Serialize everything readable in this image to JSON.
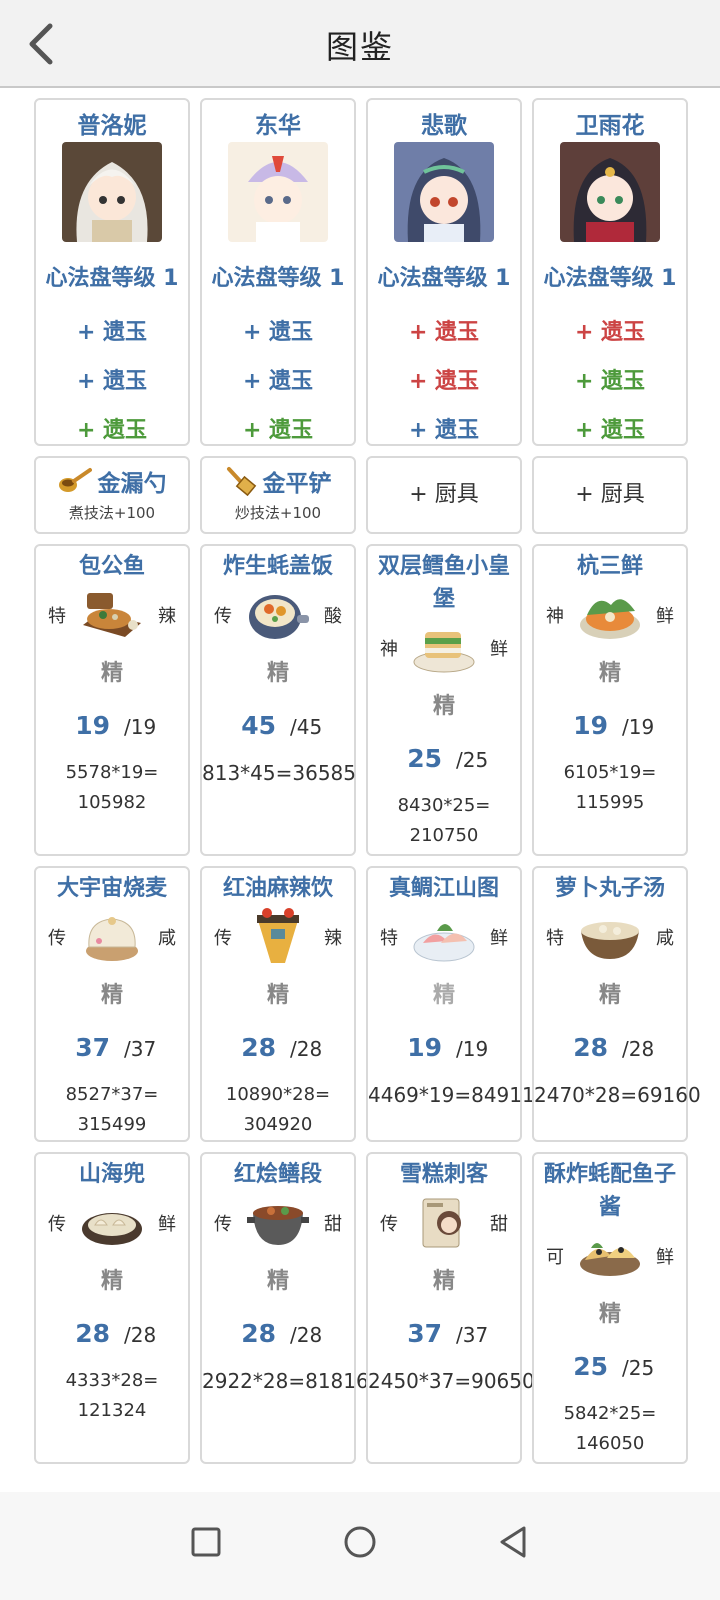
{
  "header": {
    "title": "图鉴"
  },
  "chefs": [
    {
      "name": "普洛妮",
      "level": "心法盘等级 1",
      "jades": [
        {
          "text": "+ 遗玉",
          "color": "blue"
        },
        {
          "text": "+ 遗玉",
          "color": "blue"
        },
        {
          "text": "+ 遗玉",
          "color": "green"
        }
      ]
    },
    {
      "name": "东华",
      "level": "心法盘等级 1",
      "jades": [
        {
          "text": "+ 遗玉",
          "color": "blue"
        },
        {
          "text": "+ 遗玉",
          "color": "blue"
        },
        {
          "text": "+ 遗玉",
          "color": "green"
        }
      ]
    },
    {
      "name": "悲歌",
      "level": "心法盘等级 1",
      "jades": [
        {
          "text": "+ 遗玉",
          "color": "red"
        },
        {
          "text": "+ 遗玉",
          "color": "red"
        },
        {
          "text": "+ 遗玉",
          "color": "blue"
        }
      ]
    },
    {
      "name": "卫雨花",
      "level": "心法盘等级 1",
      "jades": [
        {
          "text": "+ 遗玉",
          "color": "red"
        },
        {
          "text": "+ 遗玉",
          "color": "green"
        },
        {
          "text": "+ 遗玉",
          "color": "green"
        }
      ]
    }
  ],
  "tools": [
    {
      "name": "金漏勺",
      "desc": "煮技法+100",
      "icon": "ladle-icon"
    },
    {
      "name": "金平铲",
      "desc": "炒技法+100",
      "icon": "spatula-icon"
    },
    {
      "add": "+ 厨具"
    },
    {
      "add": "+ 厨具"
    }
  ],
  "dishes": [
    [
      {
        "name": "包公鱼",
        "left": "特",
        "right": "辣",
        "rank": "精",
        "count": "19",
        "total": "/19",
        "formula": "5578*19=\n105982",
        "icon": "fish-platter-icon"
      },
      {
        "name": "炸生蚝盖饭",
        "left": "传",
        "right": "酸",
        "rank": "精",
        "count": "45",
        "total": "/45",
        "formula": "813*45=36585",
        "icon": "rice-bowl-icon"
      },
      {
        "name": "双层鳕鱼小皇堡",
        "left": "神",
        "right": "鲜",
        "rank": "精",
        "count": "25",
        "total": "/25",
        "formula": "8430*25=\n210750",
        "icon": "burger-icon"
      },
      {
        "name": "杭三鲜",
        "left": "神",
        "right": "鲜",
        "rank": "精",
        "count": "19",
        "total": "/19",
        "formula": "6105*19=\n115995",
        "icon": "soup-plate-icon"
      }
    ],
    [
      {
        "name": "大宇宙烧麦",
        "left": "传",
        "right": "咸",
        "rank": "精",
        "count": "37",
        "total": "/37",
        "formula": "8527*37=\n315499",
        "icon": "shaomai-icon"
      },
      {
        "name": "红油麻辣饮",
        "left": "传",
        "right": "辣",
        "rank": "精",
        "count": "28",
        "total": "/28",
        "formula": "10890*28=\n304920",
        "icon": "spicy-drink-icon"
      },
      {
        "name": "真鲷江山图",
        "left": "特",
        "right": "鲜",
        "rank": "精",
        "count": "19",
        "total": "/19",
        "formula": "4469*19=84911",
        "icon": "sashimi-icon"
      },
      {
        "name": "萝卜丸子汤",
        "left": "特",
        "right": "咸",
        "rank": "精",
        "count": "28",
        "total": "/28",
        "formula": "2470*28=69160",
        "icon": "soup-bowl-icon"
      }
    ],
    [
      {
        "name": "山海兜",
        "left": "传",
        "right": "鲜",
        "rank": "精",
        "count": "28",
        "total": "/28",
        "formula": "4333*28=\n121324",
        "icon": "dumpling-plate-icon"
      },
      {
        "name": "红烩鳝段",
        "left": "传",
        "right": "甜",
        "rank": "精",
        "count": "28",
        "total": "/28",
        "formula": "2922*28=81816",
        "icon": "stew-pot-icon"
      },
      {
        "name": "雪糕刺客",
        "left": "传",
        "right": "甜",
        "rank": "精",
        "count": "37",
        "total": "/37",
        "formula": "2450*37=90650",
        "icon": "ice-cream-icon"
      },
      {
        "name": "酥炸蚝配鱼子酱",
        "left": "可",
        "right": "鲜",
        "rank": "精",
        "count": "25",
        "total": "/25",
        "formula": "5842*25=\n146050",
        "icon": "fried-oyster-icon"
      }
    ]
  ]
}
